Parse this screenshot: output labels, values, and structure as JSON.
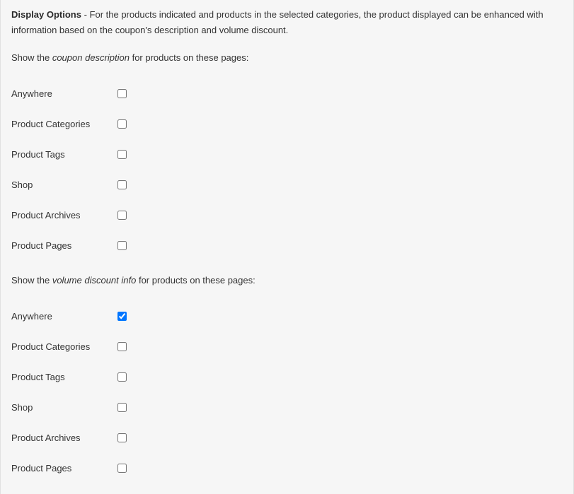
{
  "header": {
    "title": "Display Options",
    "description_prefix": " - ",
    "description": "For the products indicated and products in the selected categories, the product displayed can be enhanced with information based on the coupon's description and volume discount."
  },
  "sections": [
    {
      "prompt_prefix": "Show the ",
      "prompt_emph": "coupon description",
      "prompt_suffix": " for products on these pages:",
      "options": [
        {
          "label": "Anywhere",
          "checked": false,
          "name": "cd-anywhere"
        },
        {
          "label": "Product Categories",
          "checked": false,
          "name": "cd-product-categories"
        },
        {
          "label": "Product Tags",
          "checked": false,
          "name": "cd-product-tags"
        },
        {
          "label": "Shop",
          "checked": false,
          "name": "cd-shop"
        },
        {
          "label": "Product Archives",
          "checked": false,
          "name": "cd-product-archives"
        },
        {
          "label": "Product Pages",
          "checked": false,
          "name": "cd-product-pages"
        }
      ]
    },
    {
      "prompt_prefix": "Show the ",
      "prompt_emph": "volume discount info",
      "prompt_suffix": " for products on these pages:",
      "options": [
        {
          "label": "Anywhere",
          "checked": true,
          "name": "vd-anywhere"
        },
        {
          "label": "Product Categories",
          "checked": false,
          "name": "vd-product-categories"
        },
        {
          "label": "Product Tags",
          "checked": false,
          "name": "vd-product-tags"
        },
        {
          "label": "Shop",
          "checked": false,
          "name": "vd-shop"
        },
        {
          "label": "Product Archives",
          "checked": false,
          "name": "vd-product-archives"
        },
        {
          "label": "Product Pages",
          "checked": false,
          "name": "vd-product-pages"
        }
      ]
    }
  ]
}
